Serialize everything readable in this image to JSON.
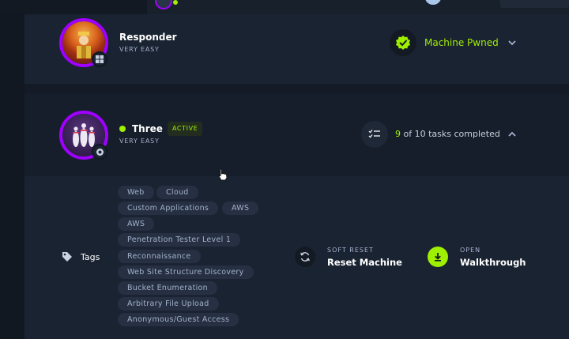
{
  "machines": [
    {
      "name": "Responder",
      "difficulty": "VERY EASY",
      "status": "Machine Pwned"
    },
    {
      "name": "Three",
      "difficulty": "VERY EASY",
      "badge": "ACTIVE",
      "tasks": {
        "completed": "9",
        "rest": "of 10 tasks completed"
      }
    }
  ],
  "details": {
    "tags_label": "Tags",
    "tags": [
      "Web",
      "Cloud",
      "Custom Applications",
      "AWS",
      "AWS",
      "Penetration Tester Level 1",
      "Reconnaissance",
      "Web Site Structure Discovery",
      "Bucket Enumeration",
      "Arbitrary File Upload",
      "Anonymous/Guest Access"
    ],
    "reset": {
      "small": "SOFT RESET",
      "big": "Reset Machine"
    },
    "walkthrough": {
      "small": "OPEN",
      "big": "Walkthrough"
    }
  },
  "colors": {
    "accent": "#9fef00",
    "avatar_ring": "#9f00ff",
    "bg": "#141b26"
  },
  "icons": {
    "responder_os": "windows-icon",
    "three_os": "linux-icon",
    "pwned": "check-badge-icon",
    "tasks": "checklist-icon",
    "tags": "tag-icon",
    "reset": "refresh-icon",
    "walkthrough": "download-icon"
  }
}
